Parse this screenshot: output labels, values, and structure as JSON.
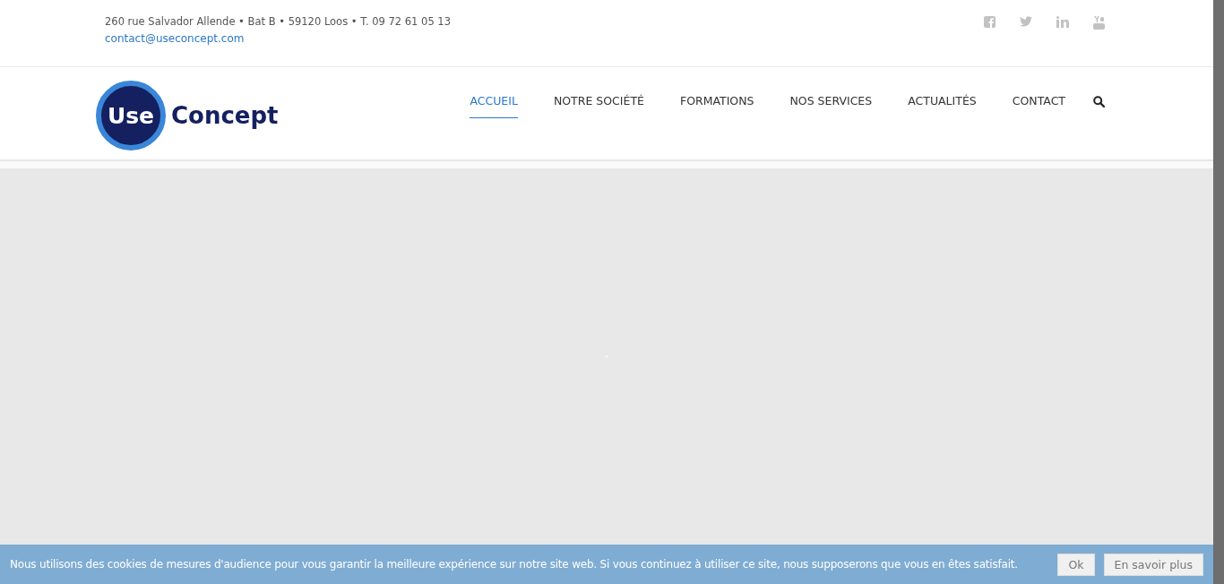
{
  "topbar": {
    "address": "260 rue Salvador Allende • Bat B • 59120 Loos • T. 09 72 61 05 13",
    "email": "contact@useconcept.com",
    "social": [
      {
        "kind": "facebook"
      },
      {
        "kind": "twitter"
      },
      {
        "kind": "linkedin"
      },
      {
        "kind": "youtube"
      }
    ]
  },
  "logo": {
    "badge": "Use",
    "name": "Concept"
  },
  "nav": [
    {
      "label": "ACCUEIL",
      "selected": true
    },
    {
      "label": "NOTRE SOCIÉTÉ",
      "selected": false
    },
    {
      "label": "FORMATIONS",
      "selected": false
    },
    {
      "label": "NOS SERVICES",
      "selected": false
    },
    {
      "label": "ACTUALITÉS",
      "selected": false
    },
    {
      "label": "CONTACT",
      "selected": false
    }
  ],
  "cookie_bar": {
    "message": "Nous utilisons des cookies de mesures d'audience pour vous garantir la meilleure expérience sur notre site web. Si vous continuez à utiliser ce site, nous supposerons que vous en êtes satisfait.",
    "buttons": [
      "Ok",
      "En savoir plus"
    ]
  }
}
